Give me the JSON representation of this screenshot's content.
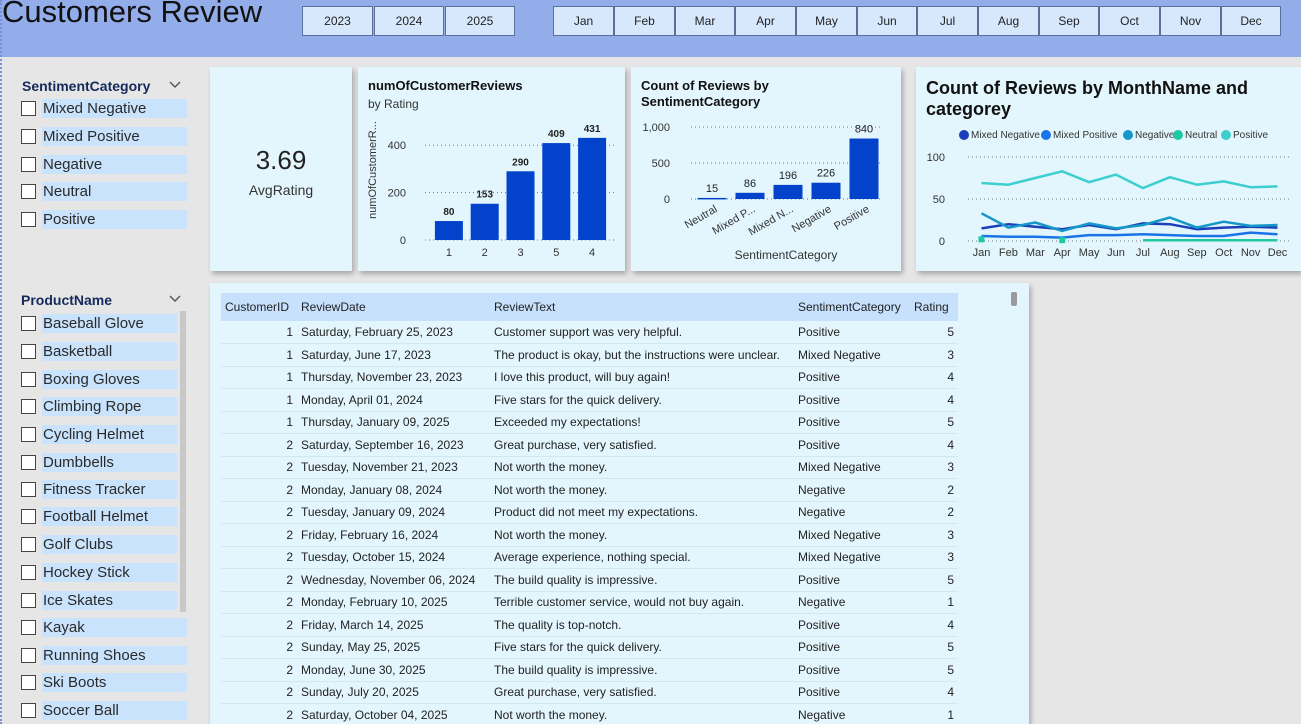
{
  "header": {
    "title": "Customers Review",
    "years": [
      "2023",
      "2024",
      "2025"
    ],
    "months": [
      "Jan",
      "Feb",
      "Mar",
      "Apr",
      "May",
      "Jun",
      "Jul",
      "Aug",
      "Sep",
      "Oct",
      "Nov",
      "Dec"
    ]
  },
  "sentiment_slicer": {
    "title": "SentimentCategory",
    "items": [
      "Mixed Negative",
      "Mixed Positive",
      "Negative",
      "Neutral",
      "Positive"
    ]
  },
  "product_slicer": {
    "title": "ProductName",
    "items": [
      "Baseball Glove",
      "Basketball",
      "Boxing Gloves",
      "Climbing Rope",
      "Cycling Helmet",
      "Dumbbells",
      "Fitness Tracker",
      "Football Helmet",
      "Golf Clubs",
      "Hockey Stick",
      "Ice Skates",
      "Kayak",
      "Running Shoes",
      "Ski Boots",
      "Soccer Ball"
    ]
  },
  "kpi": {
    "value": "3.69",
    "label": "AvgRating"
  },
  "table": {
    "headers": [
      "CustomerID",
      "ReviewDate",
      "ReviewText",
      "SentimentCategory",
      "Rating"
    ],
    "rows": [
      [
        "1",
        "Saturday, February 25, 2023",
        "Customer support was very helpful.",
        "Positive",
        "5"
      ],
      [
        "1",
        "Saturday, June 17, 2023",
        "The product is okay, but the instructions were unclear.",
        "Mixed Negative",
        "3"
      ],
      [
        "1",
        "Thursday, November 23, 2023",
        "I love this product, will buy again!",
        "Positive",
        "4"
      ],
      [
        "1",
        "Monday, April 01, 2024",
        "Five stars for the quick delivery.",
        "Positive",
        "4"
      ],
      [
        "1",
        "Thursday, January 09, 2025",
        "Exceeded my expectations!",
        "Positive",
        "5"
      ],
      [
        "2",
        "Saturday, September 16, 2023",
        "Great purchase, very satisfied.",
        "Positive",
        "4"
      ],
      [
        "2",
        "Tuesday, November 21, 2023",
        "Not worth the money.",
        "Mixed Negative",
        "3"
      ],
      [
        "2",
        "Monday, January 08, 2024",
        "Not worth the money.",
        "Negative",
        "2"
      ],
      [
        "2",
        "Tuesday, January 09, 2024",
        "Product did not meet my expectations.",
        "Negative",
        "2"
      ],
      [
        "2",
        "Friday, February 16, 2024",
        "Not worth the money.",
        "Mixed Negative",
        "3"
      ],
      [
        "2",
        "Tuesday, October 15, 2024",
        "Average experience, nothing special.",
        "Mixed Negative",
        "3"
      ],
      [
        "2",
        "Wednesday, November 06, 2024",
        "The build quality is impressive.",
        "Positive",
        "5"
      ],
      [
        "2",
        "Monday, February 10, 2025",
        "Terrible customer service, would not buy again.",
        "Negative",
        "1"
      ],
      [
        "2",
        "Friday, March 14, 2025",
        "The quality is top-notch.",
        "Positive",
        "4"
      ],
      [
        "2",
        "Sunday, May 25, 2025",
        "Five stars for the quick delivery.",
        "Positive",
        "5"
      ],
      [
        "2",
        "Monday, June 30, 2025",
        "The build quality is impressive.",
        "Positive",
        "5"
      ],
      [
        "2",
        "Sunday, July 20, 2025",
        "Great purchase, very satisfied.",
        "Positive",
        "4"
      ],
      [
        "2",
        "Saturday, October 04, 2025",
        "Not worth the money.",
        "Negative",
        "1"
      ]
    ]
  },
  "colors": {
    "header_bg": "#93acea",
    "card_bg": "#e3f6fd",
    "bar": "#0343cc",
    "mixed_negative": "#1a3fb8",
    "mixed_positive": "#1a73e8",
    "negative": "#1597c9",
    "neutral": "#1fc9a3",
    "positive": "#3dcfcf"
  },
  "chart_data": [
    {
      "type": "bar",
      "title": "numOfCustomerReviews",
      "subtitle": "by Rating",
      "ylabel": "numOfCustomerR...",
      "xlabel": "",
      "categories": [
        "1",
        "2",
        "3",
        "5",
        "4"
      ],
      "values": [
        80,
        153,
        290,
        409,
        431
      ],
      "yticks": [
        "0",
        "200",
        "400"
      ],
      "ylim": [
        0,
        460
      ],
      "grid": true
    },
    {
      "type": "bar",
      "title": "Count of Reviews by SentimentCategory",
      "xlabel": "SentimentCategory",
      "ylabel": "",
      "categories": [
        "Neutral",
        "Mixed Positive",
        "Mixed Negative",
        "Negative",
        "Positive"
      ],
      "tick_labels": [
        "Neutral",
        "Mixed P...",
        "Mixed N...",
        "Negative",
        "Positive"
      ],
      "values": [
        15,
        86,
        196,
        226,
        840
      ],
      "yticks": [
        "0",
        "500",
        "1,000"
      ],
      "ylim": [
        0,
        1000
      ],
      "grid": true
    },
    {
      "type": "line",
      "title": "Count of Reviews by MonthName and categorey",
      "legend_position": "top",
      "categories": [
        "Jan",
        "Feb",
        "Mar",
        "Apr",
        "May",
        "Jun",
        "Jul",
        "Aug",
        "Sep",
        "Oct",
        "Nov",
        "Dec"
      ],
      "yticks": [
        "0",
        "50",
        "100"
      ],
      "ylim": [
        0,
        100
      ],
      "grid": true,
      "series": [
        {
          "name": "Mixed Negative",
          "values": [
            15,
            20,
            17,
            14,
            19,
            14,
            21,
            20,
            14,
            16,
            17,
            16
          ]
        },
        {
          "name": "Mixed Positive",
          "values": [
            6,
            5,
            5,
            4,
            7,
            7,
            8,
            7,
            6,
            6,
            10,
            8
          ]
        },
        {
          "name": "Negative",
          "values": [
            33,
            16,
            22,
            12,
            21,
            15,
            19,
            28,
            16,
            23,
            18,
            19
          ]
        },
        {
          "name": "Neutral",
          "values": [
            2,
            null,
            null,
            1,
            null,
            null,
            1,
            1,
            1,
            1,
            1,
            1
          ]
        },
        {
          "name": "Positive",
          "values": [
            69,
            67,
            75,
            83,
            70,
            79,
            63,
            76,
            67,
            71,
            64,
            65
          ]
        }
      ]
    }
  ]
}
